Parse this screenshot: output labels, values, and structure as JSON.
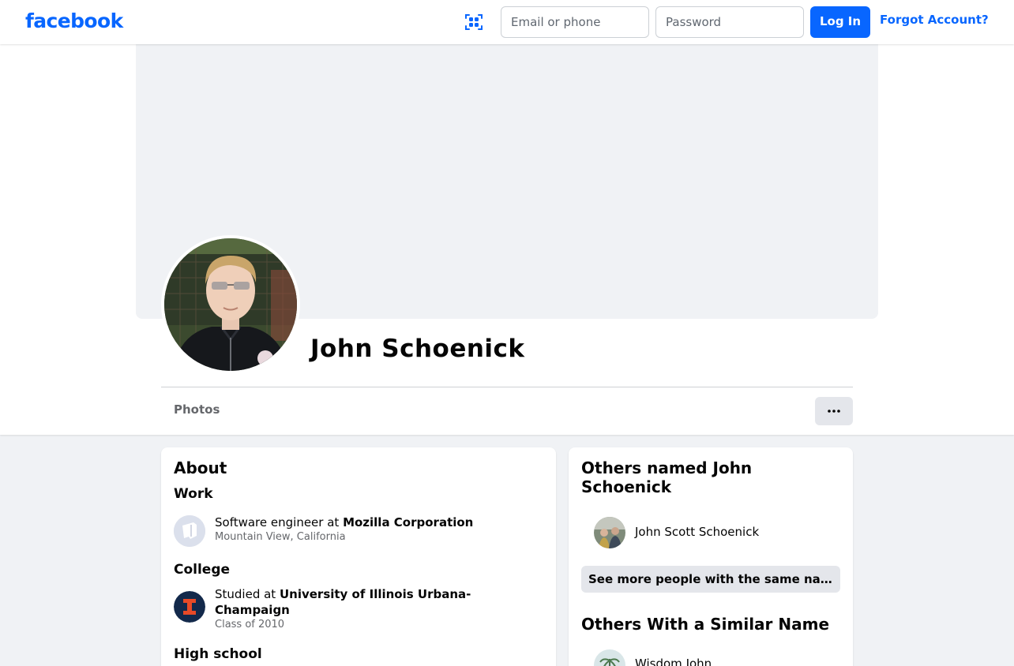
{
  "topbar": {
    "logo": "facebook",
    "email_placeholder": "Email or phone",
    "password_placeholder": "Password",
    "login_label": "Log In",
    "forgot_label": "Forgot Account?",
    "qr_icon": "qr-scan-icon"
  },
  "profile": {
    "name": "John Schoenick",
    "tabs": [
      "Photos"
    ],
    "more_icon": "more-dots-icon"
  },
  "about": {
    "title": "About",
    "work": {
      "heading": "Work",
      "prefix": "Software engineer at ",
      "employer": "Mozilla Corporation",
      "location": "Mountain View, California"
    },
    "college": {
      "heading": "College",
      "prefix": "Studied at ",
      "school_line1": "University of Illinois Urbana-",
      "school_line2": "Champaign",
      "detail": "Class of 2010"
    },
    "high_school": {
      "heading": "High school"
    }
  },
  "others_named": {
    "title_line1": "Others named John",
    "title_line2": "Schoenick",
    "people": [
      "John Scott Schoenick"
    ],
    "see_more_label": "See more people with the same name"
  },
  "similar": {
    "title": "Others With a Similar Name",
    "people": [
      "Wisdom John"
    ]
  },
  "colors": {
    "brand": "#0866ff",
    "page_bg": "#f0f2f5",
    "secondary_text": "#65676b"
  }
}
